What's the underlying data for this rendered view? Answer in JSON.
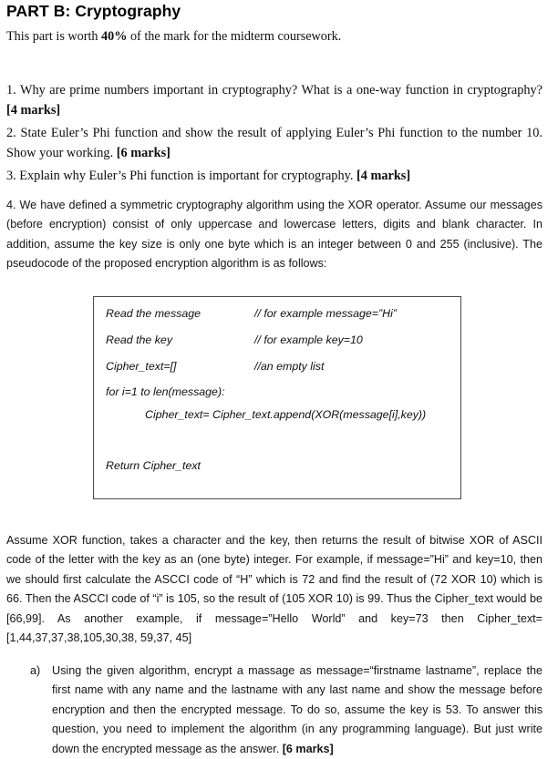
{
  "document": {
    "title": "PART B: Cryptography",
    "subtitle": {
      "before": "This part is worth ",
      "emphasis": "40%",
      "after": " of the mark for the midterm coursework."
    }
  },
  "questions": [
    {
      "id": "q1",
      "text": "1.  Why are prime numbers important in cryptography? What is a one-way function in cryptography?  ",
      "marks": "[4 marks]"
    },
    {
      "id": "q2",
      "text": "2. State Euler’s Phi function and show the result of applying Euler’s Phi function to the number 10. Show your working.  ",
      "marks": "[6 marks]"
    },
    {
      "id": "q3",
      "text": "3. Explain why Euler’s Phi function is important for cryptography.  ",
      "marks": "[4 marks]"
    },
    {
      "id": "q4",
      "text": "4.  We have defined a symmetric cryptography algorithm using the XOR operator. Assume our messages (before encryption) consist of only uppercase and lowercase letters, digits and blank character. In addition, assume the key size is only one byte which is an integer between 0 and 255 (inclusive). The pseudocode of the proposed encryption algorithm is as follows:",
      "marks": ""
    }
  ],
  "pseudocode": {
    "lines": [
      {
        "code": "Read the message",
        "comment": "// for example message=”Hi”"
      },
      {
        "code": "Read the key",
        "comment": "// for example key=10"
      },
      {
        "code": "Cipher_text=[]",
        "comment": "//an empty list"
      },
      {
        "code": "for i=1 to len(message):",
        "comment": ""
      },
      {
        "code": "Cipher_text= Cipher_text.append(XOR(message[i],key))",
        "comment": ""
      },
      {
        "code": "Return Cipher_text",
        "comment": ""
      }
    ]
  },
  "assume_paragraph": {
    "text": "Assume XOR function, takes a character and the key, then returns the result of bitwise XOR of ASCII code of the letter with the key as an (one byte) integer. For example, if message=”Hi” and key=10, then we should first calculate the ASCCI code of “H” which is 72 and find the result of (72 XOR 10) which is 66. Then the ASCCI code of “i” is 105, so the result of (105 XOR 10) is 99. Thus the Cipher_text would be [66,99]. As another example, if message=”Hello World” and key=73 then Cipher_text=[1,44,37,37,38,105,30,38, 59,37, 45]"
  },
  "sub_items": [
    {
      "marker": "a)",
      "text": "Using the given algorithm, encrypt a massage as message=“firstname lastname”, replace the  first name with any name and the lastname with any last name and show the message before encryption and then the encrypted message. To do so, assume the key is 53. To answer this question, you need to implement the algorithm (in any programming language). But just write down the encrypted message as the answer. ",
      "marks": "[6 marks]"
    }
  ]
}
